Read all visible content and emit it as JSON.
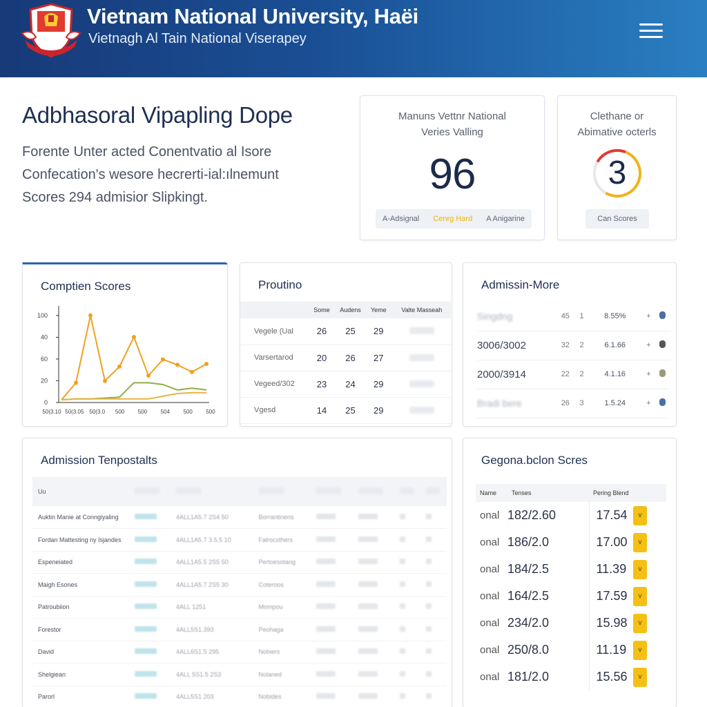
{
  "header": {
    "title": "Vietnam National University, Haёi",
    "subtitle": "Vietnagh Al Tain National Viserapey",
    "menu_icon": "hamburger-menu-icon",
    "logo": "university-crest-logo"
  },
  "hero": {
    "title": "Adbhasoral Vipapling Dope",
    "description_lines": [
      "Forente Unter acted Conentvatio al Isore",
      "Confecation's wesore hecrerti-ial:ılnemunt",
      "Scores 294 admisior Slipkingt."
    ]
  },
  "stat_cards": {
    "score": {
      "label_lines": [
        "Manuns Vettnr National",
        "Veries Valling"
      ],
      "value": "96",
      "pills": [
        "A-Adsignal",
        "Cenrg Hard",
        "A Anigarine"
      ]
    },
    "ring": {
      "label_lines": [
        "Clethane or",
        "Abimative octerls"
      ],
      "value": "3",
      "ring_fraction": 0.75,
      "ring_colors": [
        "#e03a2f",
        "#f2b21b"
      ],
      "pill": "Can Scores"
    }
  },
  "comption_scores": {
    "title": "Comptien Scores",
    "chart_data": {
      "type": "line",
      "y_ticks": [
        "100",
        "40",
        "60",
        "20",
        "0"
      ],
      "x_labels": [
        "50(3.10",
        "50(3.05",
        "50(3.0",
        "500",
        "500",
        "504",
        "500",
        "500"
      ],
      "series": [
        {
          "color": "#f0a020",
          "values": [
            3,
            22,
            97,
            24,
            40,
            73,
            30,
            48,
            42,
            34,
            43
          ]
        },
        {
          "color": "#8fae4a",
          "values": [
            3,
            4,
            4,
            5,
            6,
            22,
            22,
            20,
            14,
            16,
            14
          ]
        },
        {
          "color": "#e8b340",
          "values": [
            3,
            4,
            4,
            4,
            4,
            4,
            4,
            7,
            10,
            11,
            11
          ]
        }
      ],
      "ylim": [
        0,
        100
      ]
    }
  },
  "proutino": {
    "title": "Proutino",
    "columns": [
      "Some",
      "Audens",
      "Yeme",
      "Valte Masseah"
    ],
    "rows": [
      {
        "label": "Vegele (Ual",
        "values": [
          "26",
          "25",
          "29"
        ]
      },
      {
        "label": "Varsertarod",
        "values": [
          "20",
          "26",
          "27"
        ]
      },
      {
        "label": "Vegeed/302",
        "values": [
          "23",
          "24",
          "29"
        ]
      },
      {
        "label": "Vgesd",
        "values": [
          "14",
          "25",
          "29"
        ]
      }
    ]
  },
  "admission_more": {
    "title": "Admissin-More",
    "rows": [
      {
        "label": "Singdng",
        "a": "45",
        "b": "1",
        "c": "8.55%",
        "d": "+"
      },
      {
        "label": "3006/3002",
        "a": "32",
        "b": "2",
        "c": "6.1.66",
        "d": "+"
      },
      {
        "label": "2000/3914",
        "a": "22",
        "b": "2",
        "c": "4.1.16",
        "d": "+"
      },
      {
        "label": "Bradi bere",
        "a": "26",
        "b": "3",
        "c": "1.5.24",
        "d": "+"
      }
    ]
  },
  "admission_template": {
    "title": "Admission Tenpostalts",
    "header_first": "Uu",
    "rows": [
      {
        "name": "Auktin Manie at Conngiyaling",
        "code": "4ALL1A5.7 2S4 50",
        "type": "Borrantinens"
      },
      {
        "name": "Fordan Mattesting ny Isjandes",
        "code": "4ALL1A5.7 3.5.5 10",
        "type": "Falrocsthers"
      },
      {
        "name": "Espeneiated",
        "code": "4ALL1A5.5 2S5 50",
        "type": "Pertoesotang"
      },
      {
        "name": "Maigh Esones",
        "code": "4ALL1A5.7 2S5 30",
        "type": "Coteroos"
      },
      {
        "name": "Patroubiion",
        "code": "4ALL 1251",
        "type": "Mompou"
      },
      {
        "name": "Forestor",
        "code": "4ALL5S1.393",
        "type": "Peohaga"
      },
      {
        "name": "David",
        "code": "4ALL6S1.5 295",
        "type": "Nobiers"
      },
      {
        "name": "Shelgiean",
        "code": "4ALL 5S1.5 2S3",
        "type": "Nolaned"
      },
      {
        "name": "Parorl",
        "code": "4ALL5S1 203",
        "type": "Nobides"
      }
    ]
  },
  "regional_scores": {
    "title": "Gegona.bclon Scres",
    "columns": [
      "Name",
      "Tenses",
      "Pering Blend"
    ],
    "button_glyph": "v",
    "rows": [
      {
        "name": "onal",
        "score": "182/2.60",
        "points": "17.54"
      },
      {
        "name": "onal",
        "score": "186/2.0",
        "points": "17.00"
      },
      {
        "name": "onal",
        "score": "184/2.5",
        "points": "11.39"
      },
      {
        "name": "onal",
        "score": "164/2.5",
        "points": "17.59"
      },
      {
        "name": "onal",
        "score": "234/2.0",
        "points": "15.98"
      },
      {
        "name": "onal",
        "score": "250/8.0",
        "points": "11.19"
      },
      {
        "name": "onal",
        "score": "181/2.0",
        "points": "15.56"
      }
    ]
  }
}
